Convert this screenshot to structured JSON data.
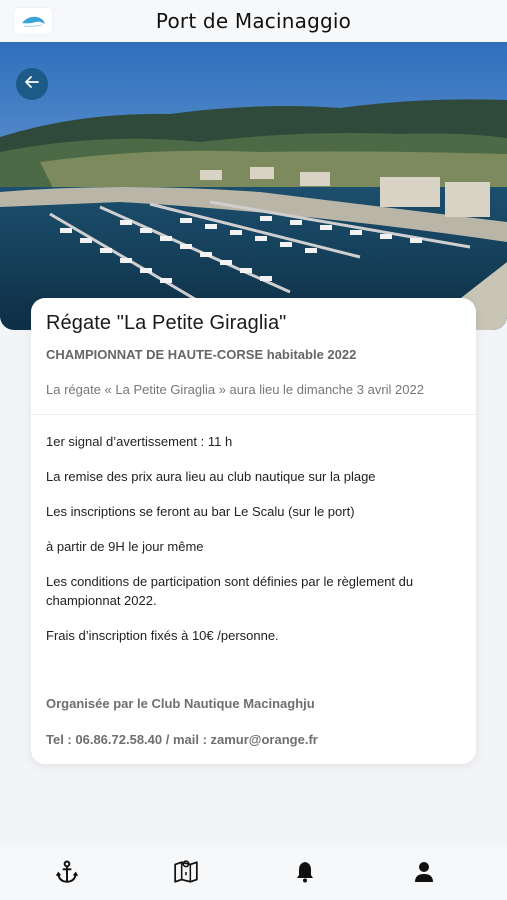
{
  "header": {
    "title": "Port de Macinaggio",
    "logo_icon": "dolphin-logo-icon"
  },
  "hero": {
    "image": "aerial-harbor-photo",
    "back_icon": "arrow-left-icon"
  },
  "event": {
    "title": "Régate \"La Petite Giraglia\"",
    "subtitle": "CHAMPIONNAT DE HAUTE-CORSE habitable 2022",
    "summary": "La régate « La Petite Giraglia » aura lieu le dimanche 3 avril 2022",
    "details": [
      "1er signal d’avertissement : 11 h",
      "La remise des prix aura lieu au club nautique sur la plage",
      "Les inscriptions se feront au bar Le Scalu (sur le port)",
      "à partir de 9H le jour même",
      "Les conditions de participation sont définies par le règlement du championnat 2022.",
      "Frais d’inscription fixés à 10€ /personne."
    ],
    "organiser": "Organisée par le Club Nautique Macinaghju",
    "contact": "Tel : 06.86.72.58.40 / mail : zamur@orange.fr"
  },
  "nav": {
    "items": [
      {
        "icon": "anchor-icon"
      },
      {
        "icon": "map-icon"
      },
      {
        "icon": "bell-icon"
      },
      {
        "icon": "user-icon"
      }
    ]
  },
  "colors": {
    "accent": "#1d5a87",
    "background": "#f2f4f7",
    "card": "#ffffff"
  }
}
